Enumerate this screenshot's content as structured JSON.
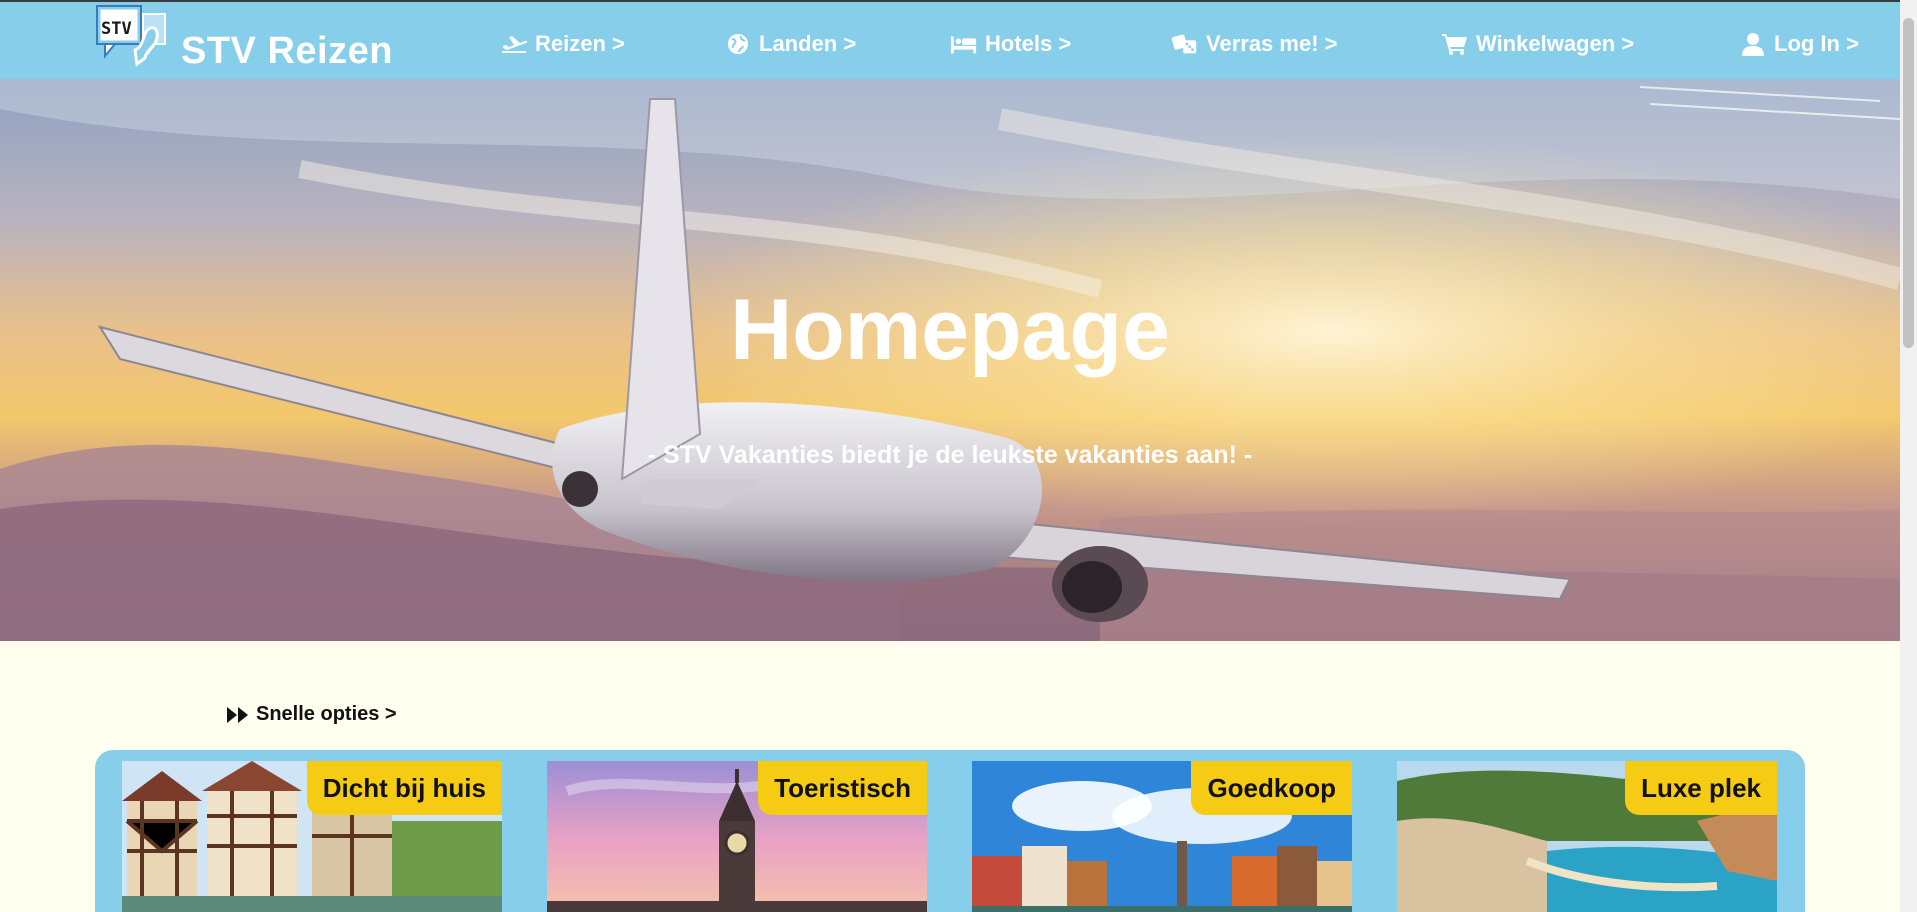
{
  "header": {
    "logo_text": "STV",
    "brand": "STV Reizen",
    "nav": [
      {
        "label": "Reizen >",
        "icon": "plane-icon"
      },
      {
        "label": "Landen >",
        "icon": "globe-icon"
      },
      {
        "label": "Hotels >",
        "icon": "bed-icon"
      },
      {
        "label": "Verras me! >",
        "icon": "dice-icon"
      },
      {
        "label": "Winkelwagen >",
        "icon": "cart-icon"
      },
      {
        "label": "Log In >",
        "icon": "user-icon"
      }
    ]
  },
  "hero": {
    "title": "Homepage",
    "subtitle": "- STV Vakanties biedt je de leukste vakanties aan! -"
  },
  "quick_options": {
    "label": "Snelle opties >"
  },
  "cards": [
    {
      "tag": "Dicht bij huis"
    },
    {
      "tag": "Toeristisch"
    },
    {
      "tag": "Goedkoop"
    },
    {
      "tag": "Luxe plek"
    }
  ],
  "colors": {
    "nav_bg": "#87ceeb",
    "page_bg": "#fffff0",
    "tag_bg": "#f5cb14"
  }
}
